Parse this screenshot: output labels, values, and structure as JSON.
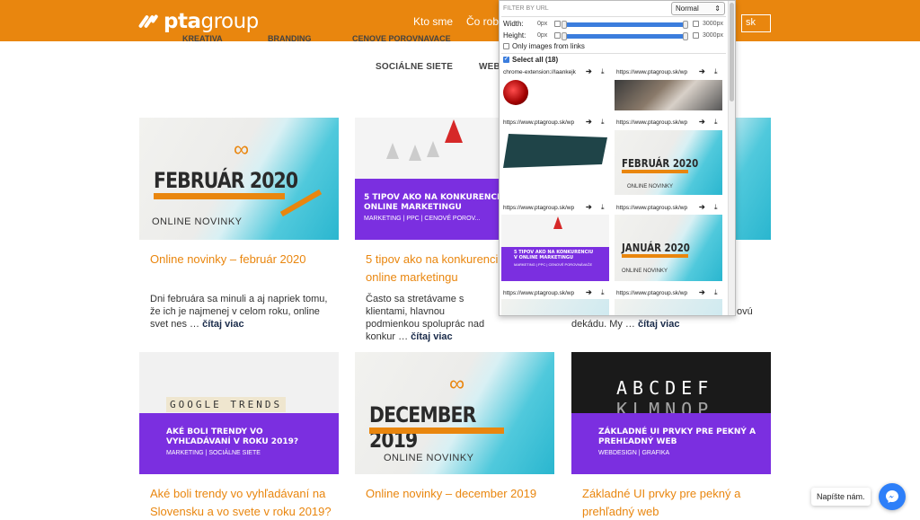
{
  "header": {
    "logo_text_a": "pta",
    "logo_text_b": "group",
    "nav": [
      {
        "label": "Kto sme"
      },
      {
        "label": "Čo robím"
      }
    ],
    "language": "sk"
  },
  "categories": {
    "row1_visible": [
      "KREATIVA",
      "BRANDING",
      "CENOVE POROVNAVACE"
    ],
    "row2": [
      "SOCIÁLNE SIETE",
      "WEB"
    ]
  },
  "posts": [
    {
      "title": "Online novinky – február 2020",
      "excerpt": "Dni februára sa minuli a aj napriek tomu, že ich je najmenej v celom roku, online svet nes …",
      "read_more": "čítaj viac",
      "image": {
        "headline": "FEBRUÁR 2020",
        "sub": "ONLINE NOVINKY"
      }
    },
    {
      "title": "5 tipov ako na konkurenciu v online marketingu",
      "title_visible": "5 tipov ako na konkurenci online marketingu",
      "excerpt": "Často sa stretávame s klientami, hlavnou podmienkou spoluprác nad konkur …",
      "read_more": "čítaj viac",
      "image": {
        "headline": "5 TIPOV AKO NA KONKURENCIU V ONLINE MARKETINGU",
        "sub": "MARKETING | PPC | CENOVÉ POROV..."
      }
    },
    {
      "excerpt_tail_1": "ovú",
      "excerpt_tail_2": "dekádu. My …",
      "read_more": "čítaj viac"
    },
    {
      "title": "Aké boli trendy vo vyhľadávaní na Slovensku a vo svete v roku 2019?",
      "image": {
        "banner": "GOOGLE TRENDS",
        "headline": "AKÉ BOLI TRENDY VO VYHĽADÁVANÍ V ROKU 2019?",
        "sub": "MARKETING | SOCIÁLNE SIETE"
      }
    },
    {
      "title": "Online novinky – december 2019",
      "image": {
        "headline": "DECEMBER 2019",
        "sub": "ONLINE NOVINKY"
      }
    },
    {
      "title": "Základné UI prvky pre pekný a prehľadný web",
      "image": {
        "letters1": "ABCDEF",
        "letters2": "KLMNOP",
        "headline": "ZÁKLADNÉ UI PRVKY PRE PEKNÝ A PREHĽADNÝ WEB",
        "sub": "WEBDESIGN | GRAFIKA"
      }
    }
  ],
  "extension": {
    "filter_placeholder": "FILTER BY URL",
    "mode": "Normal",
    "width_label": "Width:",
    "height_label": "Height:",
    "min_px": "0px",
    "max_px": "3000px",
    "only_links": "Only images from links",
    "select_all": "Select all (18)",
    "items": [
      {
        "url": "chrome-extension://laankejk",
        "kind": "red-dot"
      },
      {
        "url": "https://www.ptagroup.sk/wp",
        "kind": "photo"
      },
      {
        "url": "https://www.ptagroup.sk/wp",
        "kind": "shape"
      },
      {
        "url": "https://www.ptagroup.sk/wp",
        "kind": "feb",
        "headline": "FEBRUÁR 2020",
        "sub": "ONLINE NOVINKY"
      },
      {
        "url": "https://www.ptagroup.sk/wp",
        "kind": "tips",
        "headline": "5 TIPOV AKO NA KONKURENCIU V ONLINE MARKETINGU",
        "sub": "MARKETING | PPC | CENOVÉ POROVNÁVAČE"
      },
      {
        "url": "https://www.ptagroup.sk/wp",
        "kind": "jan",
        "headline": "JANUÁR 2020",
        "sub": "ONLINE NOVINKY"
      },
      {
        "url": "https://www.ptagroup.sk/wp"
      },
      {
        "url": "https://www.ptagroup.sk/wp"
      }
    ]
  },
  "messenger": {
    "tooltip": "Napíšte nám."
  },
  "colors": {
    "brand_orange": "#e9860e",
    "purple": "#7b2fe0",
    "accent_blue": "#2d7ff9"
  }
}
